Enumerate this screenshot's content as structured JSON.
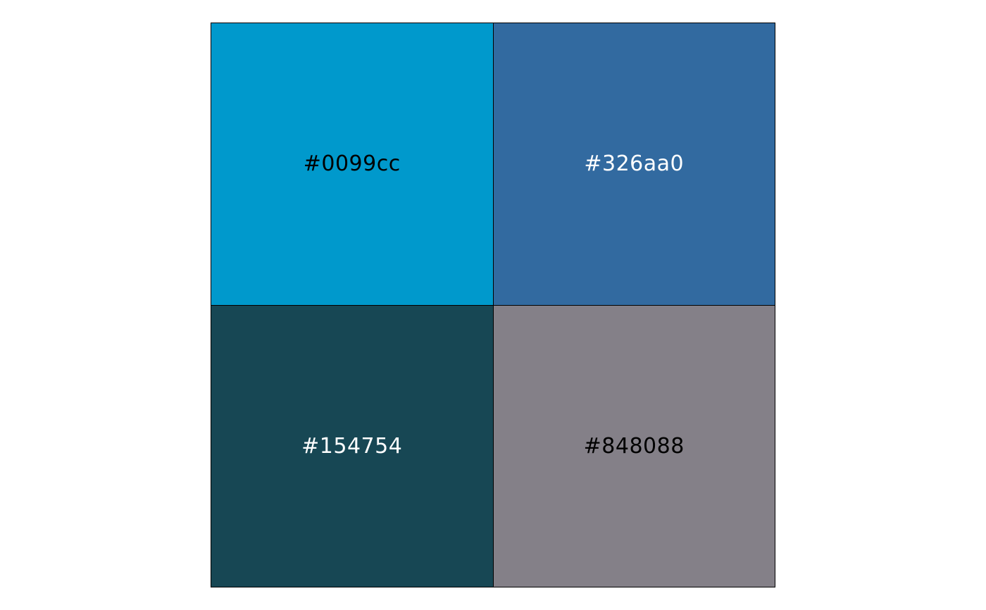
{
  "swatches": [
    {
      "label": "#0099cc",
      "color": "#0099cc",
      "text_color": "#000000"
    },
    {
      "label": "#326aa0",
      "color": "#326aa0",
      "text_color": "#ffffff"
    },
    {
      "label": "#154754",
      "color": "#174754",
      "text_color": "#ffffff"
    },
    {
      "label": "#848088",
      "color": "#848088",
      "text_color": "#000000"
    }
  ]
}
